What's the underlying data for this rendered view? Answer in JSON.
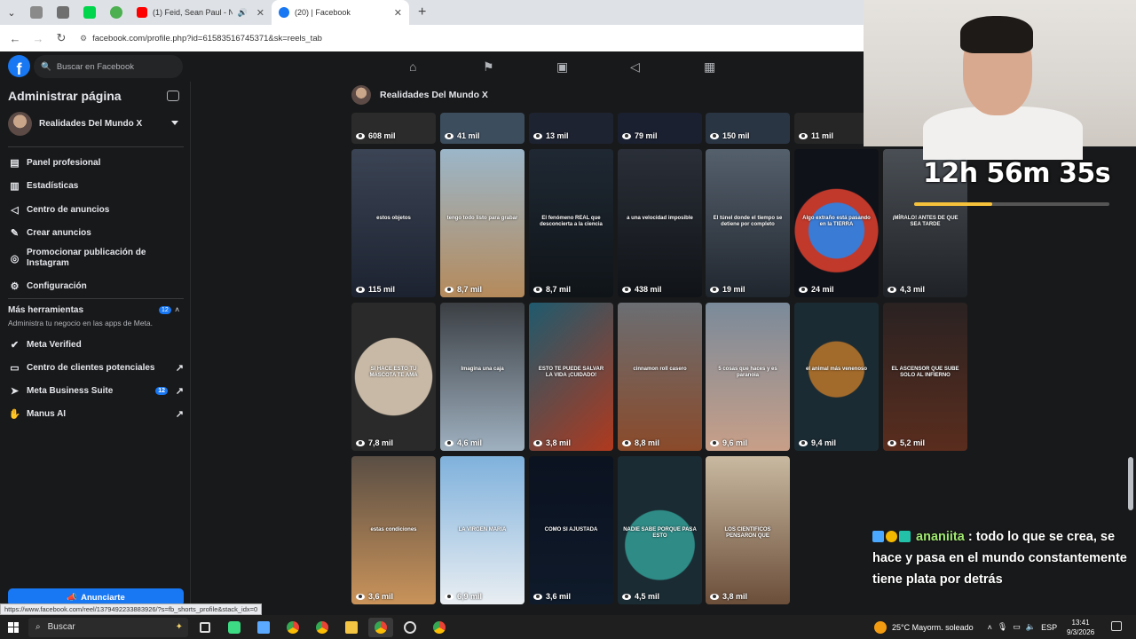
{
  "browser": {
    "tabs": [
      {
        "title": "(1) Feid, Sean Paul - Niña B...",
        "active": false
      },
      {
        "title": "(20) | Facebook",
        "active": true
      }
    ],
    "url": "facebook.com/profile.php?id=61583516745371&sk=reels_tab",
    "status_url": "https://www.facebook.com/reel/1379492233883926/?s=fb_shorts_profile&stack_idx=0"
  },
  "fb": {
    "logo": "f",
    "search_placeholder": "Buscar en Facebook",
    "nav_icons": [
      "home-icon",
      "flag-icon",
      "video-icon",
      "megaphone-icon",
      "marketplace-icon"
    ]
  },
  "sidebar": {
    "title": "Administrar página",
    "page_name": "Realidades Del Mundo X",
    "items": [
      {
        "label": "Panel profesional",
        "icon": "dashboard-icon"
      },
      {
        "label": "Estadísticas",
        "icon": "stats-icon"
      },
      {
        "label": "Centro de anuncios",
        "icon": "megaphone-icon"
      },
      {
        "label": "Crear anuncios",
        "icon": "edit-icon"
      },
      {
        "label": "Promocionar publicación de Instagram",
        "icon": "instagram-icon"
      },
      {
        "label": "Configuración",
        "icon": "gear-icon"
      }
    ],
    "tools_title": "Más herramientas",
    "tools_badge": "12",
    "tools_subtitle": "Administra tu negocio en las apps de Meta.",
    "tools": [
      {
        "label": "Meta Verified",
        "icon": "verified-icon",
        "badge": "",
        "external": false
      },
      {
        "label": "Centro de clientes potenciales",
        "icon": "leads-icon",
        "badge": "",
        "external": true
      },
      {
        "label": "Meta Business Suite",
        "icon": "business-suite-icon",
        "badge": "12",
        "external": true
      },
      {
        "label": "Manus AI",
        "icon": "manus-icon",
        "badge": "",
        "external": true
      }
    ],
    "cta": "Anunciarte"
  },
  "main": {
    "page_name": "Realidades Del Mundo X",
    "row0": [
      "608 mil",
      "41 mil",
      "13 mil",
      "79 mil",
      "150 mil",
      "11 mil"
    ],
    "row1": [
      {
        "views": "115 mil",
        "caption": "estos objetos"
      },
      {
        "views": "8,7 mil",
        "caption": "tengo todo listo para grabar"
      },
      {
        "views": "8,7 mil",
        "caption": "El fenómeno REAL que desconcierta a la ciencia"
      },
      {
        "views": "438 mil",
        "caption": "a una velocidad imposible"
      },
      {
        "views": "19 mil",
        "caption": "El túnel donde el tiempo se detiene por completo"
      },
      {
        "views": "24 mil",
        "caption": "Algo extraño está pasando en la TIERRA"
      },
      {
        "views": "4,3 mil",
        "caption": "¡MÍRALO! ANTES DE QUE SEA TARDE"
      }
    ],
    "row2": [
      {
        "views": "7,8 mil",
        "caption": "SI HACE ESTO TU MASCOTA TE AMA"
      },
      {
        "views": "4,6 mil",
        "caption": "Imagina una caja"
      },
      {
        "views": "3,8 mil",
        "caption": "ESTO TE PUEDE SALVAR LA VIDA ¡CUIDADO!"
      },
      {
        "views": "8,8 mil",
        "caption": "cinnamon roll casero"
      },
      {
        "views": "9,6 mil",
        "caption": "5 cosas que haces y es paranoia"
      },
      {
        "views": "9,4 mil",
        "caption": "el animal más venenoso"
      },
      {
        "views": "5,2 mil",
        "caption": "EL ASCENSOR QUE SUBE SOLO AL INFIERNO"
      }
    ],
    "row3": [
      {
        "views": "3,6 mil",
        "caption": "estas condiciones"
      },
      {
        "views": "6,9 mil",
        "caption": "LA VIRGEN MARIA"
      },
      {
        "views": "3,6 mil",
        "caption": "COMO SI AJUSTADA"
      },
      {
        "views": "4,5 mil",
        "caption": "NADIE SABE PORQUE PASA ESTO"
      },
      {
        "views": "3,8 mil",
        "caption": "LOS CIENTIFICOS PENSARON QUE"
      }
    ]
  },
  "overlay": {
    "timer": "12h 56m 35s",
    "timer_progress": 0.4,
    "chat_user": "ananiita",
    "chat_message": " : todo lo que se crea, se hace y pasa en el mundo constantemente tiene plata por detrás"
  },
  "taskbar": {
    "search": "Buscar",
    "weather": "25°C  Mayorm. soleado",
    "lang": "ESP",
    "time": "13:41",
    "date": "9/3/2026"
  }
}
